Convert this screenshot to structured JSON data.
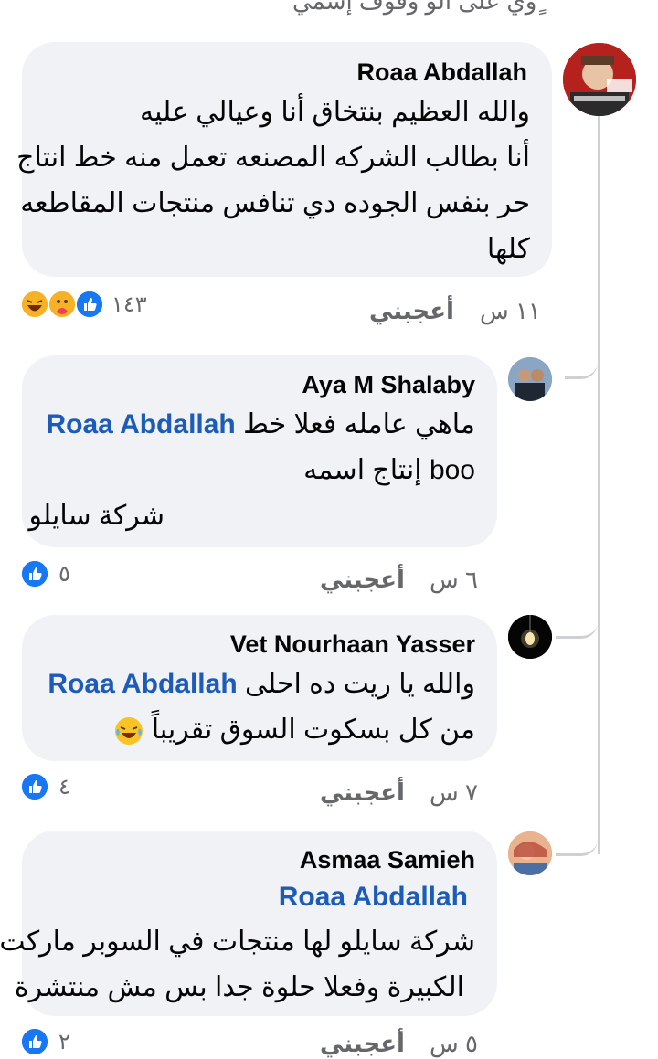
{
  "top_cut_text": "ٍوي على الو وقوف إسمي",
  "comments": [
    {
      "author": "Roaa Abdallah",
      "lines": [
        "والله العظيم بنتخاق أنا وعيالي عليه",
        "أنا بطالب الشركه المصنعه تعمل منه خط انتاج",
        "حر بنفس الجوده دي تنافس منتجات المقاطعه",
        "كلها"
      ],
      "time": "١١ س",
      "like_label": "أعجبني",
      "reaction_count": "١٤٣"
    },
    {
      "author": "Aya M Shalaby",
      "mention": "Roaa Abdallah",
      "line1_text": "ماهي عامله فعلا خط",
      "line2": "boo إنتاج اسمه",
      "line3": "شركة سايلو",
      "time": "٦ س",
      "like_label": "أعجبني",
      "reaction_count": "٥"
    },
    {
      "author": "Vet Nourhaan Yasser",
      "mention": "Roaa Abdallah",
      "line1_text": "والله يا ريت ده احلى",
      "line2": "من كل بسكوت السوق تقريباً",
      "time": "٧ س",
      "like_label": "أعجبني",
      "reaction_count": "٤"
    },
    {
      "author": "Asmaa Samieh",
      "mention": "Roaa Abdallah",
      "line2": "شركة سايلو لها منتجات في السوبر ماركت",
      "line3": "الكبيرة وفعلا حلوة جدا بس مش منتشرة",
      "time": "٥ س",
      "like_label": "أعجبني",
      "reaction_count": "٢"
    }
  ],
  "colors": {
    "bubble": "#f0f2f5",
    "mention": "#1c5bb8",
    "meta": "#65676b",
    "like": "#1877f2",
    "thread_line": "#ced0d4"
  }
}
